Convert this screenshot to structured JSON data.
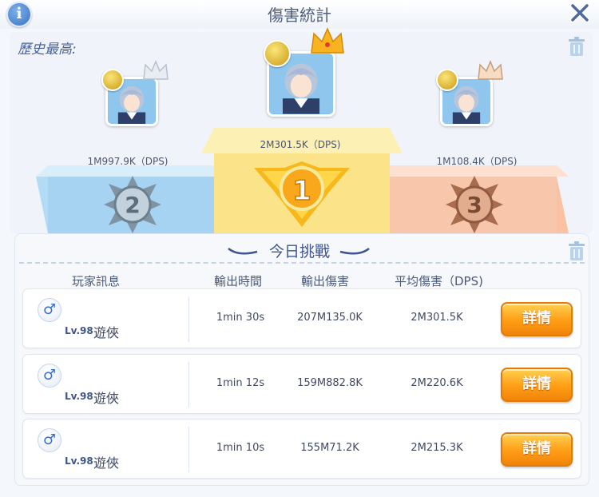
{
  "header": {
    "title": "傷害統計",
    "info_icon": "info-icon",
    "close_icon": "close-icon"
  },
  "history": {
    "label": "歷史最高:",
    "podium": [
      {
        "rank": 2,
        "dps": "1M997.9K（DPS)",
        "badge_color": "#8fa3b3",
        "crown_color": "#dfe7f0"
      },
      {
        "rank": 1,
        "dps": "2M301.5K（DPS)",
        "badge_color": "#f7c21f",
        "crown_color": "#f8b11a"
      },
      {
        "rank": 3,
        "dps": "1M108.4K（DPS)",
        "badge_color": "#b67a5c",
        "crown_color": "#f1d0b4"
      }
    ]
  },
  "today": {
    "title": "今日挑戰",
    "columns": [
      "玩家訊息",
      "輸出時間",
      "輸出傷害",
      "平均傷害（DPS)"
    ],
    "rows": [
      {
        "gender": "♂",
        "level": "Lv.98",
        "class": "遊俠",
        "time": "1min 30s",
        "damage": "207M135.0K",
        "avg": "2M301.5K",
        "button": "詳情"
      },
      {
        "gender": "♂",
        "level": "Lv.98",
        "class": "遊俠",
        "time": "1min 12s",
        "damage": "159M882.8K",
        "avg": "2M220.6K",
        "button": "詳情"
      },
      {
        "gender": "♂",
        "level": "Lv.98",
        "class": "遊俠",
        "time": "1min 10s",
        "damage": "155M71.2K",
        "avg": "2M215.3K",
        "button": "詳情"
      }
    ]
  },
  "colors": {
    "accent": "#3d5591",
    "button": "#ff9d14",
    "gold": "#f7c21f",
    "silver": "#8fa3b3",
    "bronze": "#b67a5c"
  }
}
